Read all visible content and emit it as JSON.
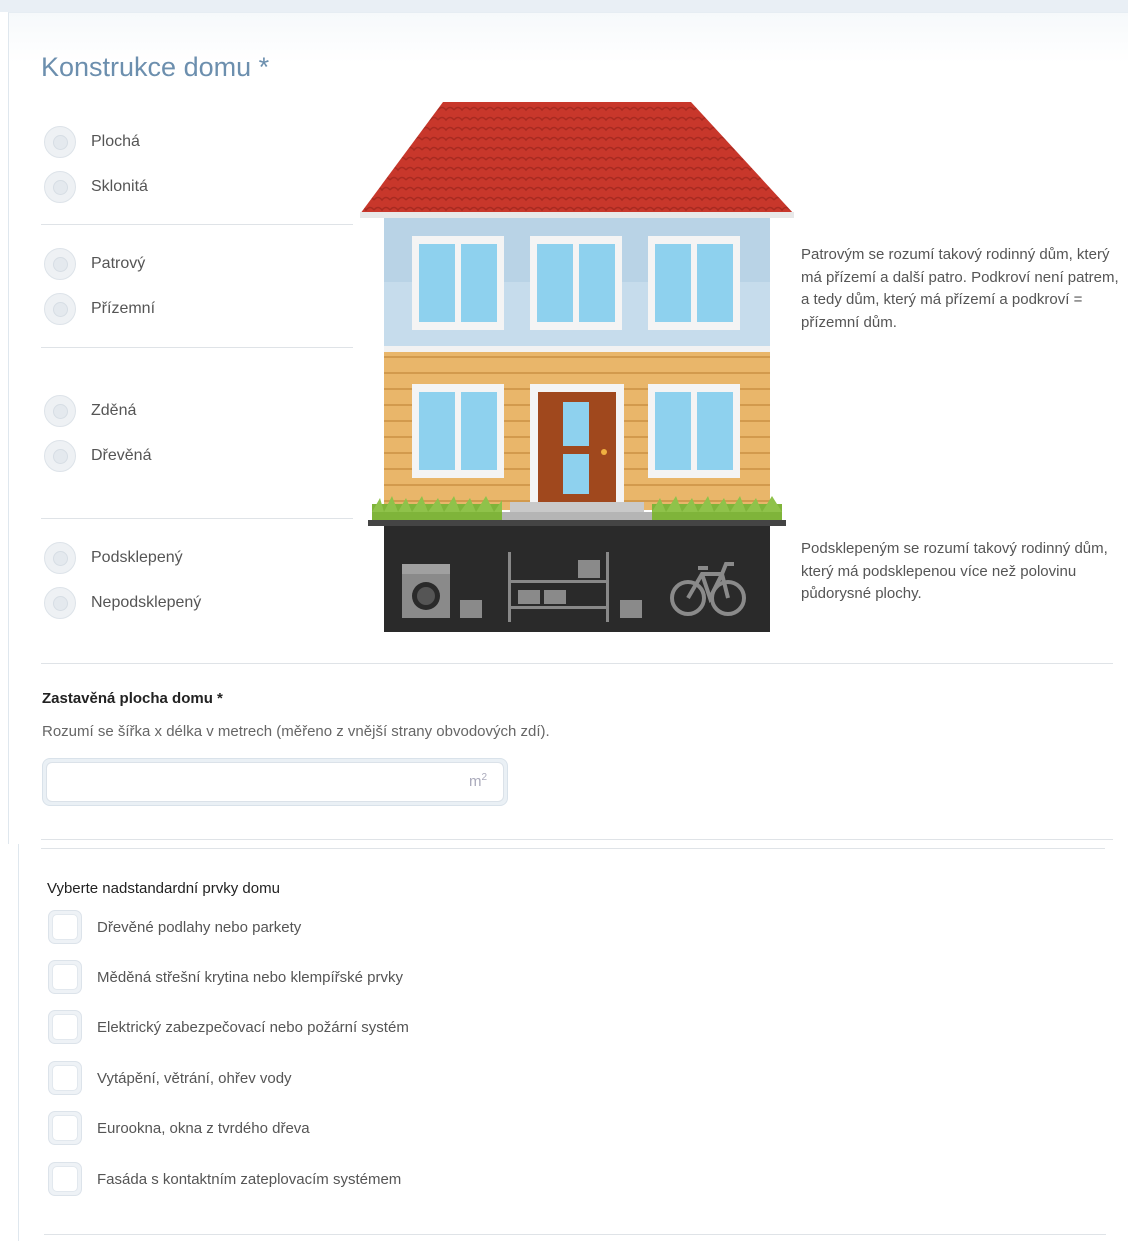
{
  "section": {
    "title": "Konstrukce domu *"
  },
  "radio_groups": {
    "roof": [
      "Plochá",
      "Sklonitá"
    ],
    "floors": [
      "Patrový",
      "Přízemní"
    ],
    "material": [
      "Zděná",
      "Dřevěná"
    ],
    "basement": [
      "Podsklepený",
      "Nepodsklepený"
    ]
  },
  "descriptions": {
    "floors": "Patrovým se rozumí takový rodinný dům, který má přízemí a další patro. Podkroví není patrem, a tedy dům, který má přízemí a podkroví = přízemní dům.",
    "basement": "Podsklepeným se rozumí takový rodinný dům, který má podsklepenou více než polovinu půdorysné plochy."
  },
  "area": {
    "label": "Zastavěná plocha domu *",
    "help": "Rozumí se šířka x délka v metrech (měřeno z vnější strany obvodových zdí).",
    "value": "",
    "unit": "m",
    "unit_exp": "2"
  },
  "extras": {
    "title": "Vyberte nadstandardní prvky domu",
    "items": [
      "Dřevěné podlahy nebo parkety",
      "Měděná střešní krytina nebo klempířské prvky",
      "Elektrický zabezpečovací nebo požární systém",
      "Vytápění, větrání, ohřev vody",
      "Eurookna, okna z tvrdého dřeva",
      "Fasáda s kontaktním zateplovacím systémem"
    ]
  },
  "colors": {
    "title": "#6c8fae",
    "roof": "#c8372b",
    "upper_wall": "#b9d3e6",
    "lower_wall": "#e9b66a",
    "basement": "#2a2a2a",
    "window": "#8ed1ee",
    "door": "#a0481d",
    "grass": "#7fb43a"
  }
}
